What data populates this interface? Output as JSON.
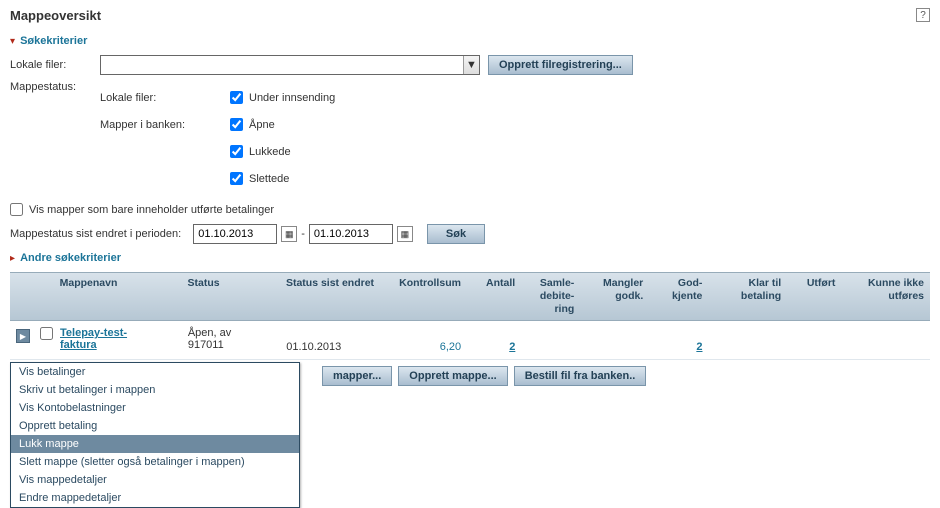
{
  "header": {
    "title": "Mappeoversikt",
    "help_tooltip": "?"
  },
  "search_criteria": {
    "toggle_label": "Søkekriterier",
    "lokale_filer_label": "Lokale filer:",
    "opprett_filreg_btn": "Opprett filregistrering...",
    "mappestatus_label": "Mappestatus:",
    "sub_lokale_filer": "Lokale filer:",
    "sub_mapper_i_banken": "Mapper i banken:",
    "cb_under_innsending": "Under innsending",
    "cb_apne": "Åpne",
    "cb_lukkede": "Lukkede",
    "cb_slettede": "Slettede",
    "cb_vis_utforte": "Vis mapper som bare inneholder utførte betalinger",
    "periode_label": "Mappestatus sist endret i perioden:",
    "date_from": "01.10.2013",
    "date_to": "01.10.2013",
    "sok_btn": "Søk"
  },
  "other_criteria": {
    "toggle_label": "Andre søkekriterier"
  },
  "table": {
    "headers": {
      "mappenavn": "Mappenavn",
      "status": "Status",
      "status_sist_endret": "Status sist endret",
      "kontrollsum": "Kontrollsum",
      "antall": "Antall",
      "samledebitering": "Samle-debite-ring",
      "mangler_godk": "Mangler godk.",
      "godkjente": "God-kjente",
      "klar_til_betaling": "Klar til betaling",
      "utfort": "Utført",
      "kunne_ikke_utfores": "Kunne ikke utføres"
    },
    "rows": [
      {
        "mappenavn": "Telepay-test-\nfaktura",
        "status": "Åpen, av\n917011",
        "status_sist_endret": "01.10.2013",
        "kontrollsum": "6,20",
        "antall": "2",
        "samledebitering": "",
        "mangler_godk": "",
        "godkjente": "2",
        "klar_til_betaling": "",
        "utfort": "",
        "kunne_ikke_utfores": ""
      }
    ],
    "action_buttons": {
      "mapper": "mapper...",
      "opprett_mappe": "Opprett mappe...",
      "bestill_fil": "Bestill fil fra banken.."
    }
  },
  "context_menu": {
    "items": [
      {
        "label": "Vis betalinger",
        "selected": false
      },
      {
        "label": "Skriv ut betalinger i mappen",
        "selected": false
      },
      {
        "label": "Vis Kontobelastninger",
        "selected": false
      },
      {
        "label": "Opprett betaling",
        "selected": false
      },
      {
        "label": "Lukk mappe",
        "selected": true
      },
      {
        "label": "Slett mappe (sletter også betalinger i mappen)",
        "selected": false
      },
      {
        "label": "Vis mappedetaljer",
        "selected": false
      },
      {
        "label": "Endre mappedetaljer",
        "selected": false
      }
    ]
  }
}
